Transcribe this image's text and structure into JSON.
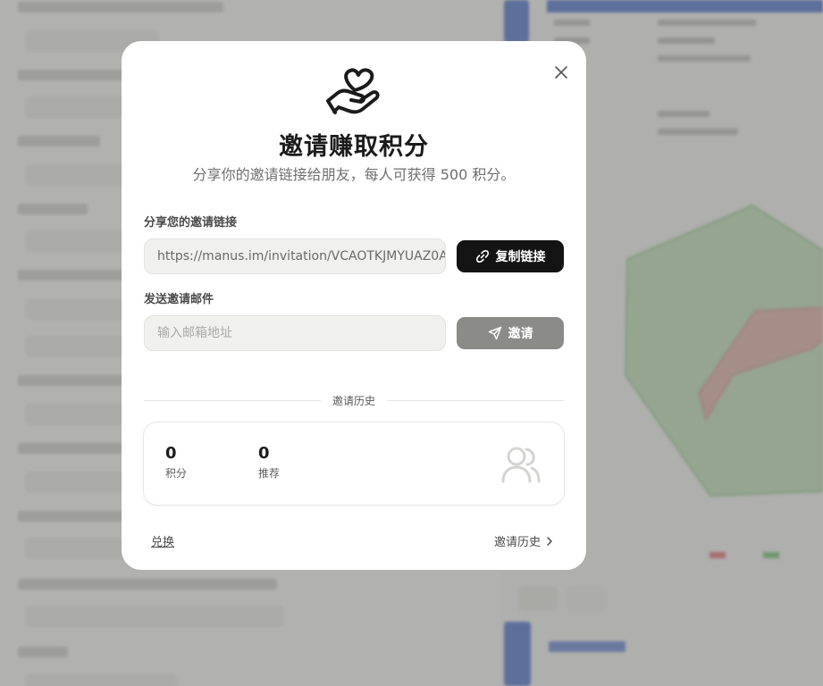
{
  "modal": {
    "title": "邀请赚取积分",
    "subtitle": "分享你的邀请链接给朋友，每人可获得 500 积分。",
    "share_label": "分享您的邀请链接",
    "invite_link": "https://manus.im/invitation/VCAOTKJMYUAZ0A",
    "copy_button": "复制链接",
    "email_label": "发送邀请邮件",
    "email_placeholder": "输入邮箱地址",
    "invite_button": "邀请",
    "history_divider": "邀请历史",
    "stats": {
      "points_value": "0",
      "points_label": "积分",
      "referrals_value": "0",
      "referrals_label": "推荐"
    },
    "redeem_link": "兑换",
    "history_link": "邀请历史"
  },
  "colors": {
    "primary_button": "#141414",
    "disabled_button": "#8b8b8a",
    "overlay": "rgba(120,120,118,0.55)"
  },
  "icons": [
    "heart-hand-icon",
    "close-icon",
    "link-icon",
    "send-icon",
    "users-icon",
    "chevron-right-icon"
  ]
}
